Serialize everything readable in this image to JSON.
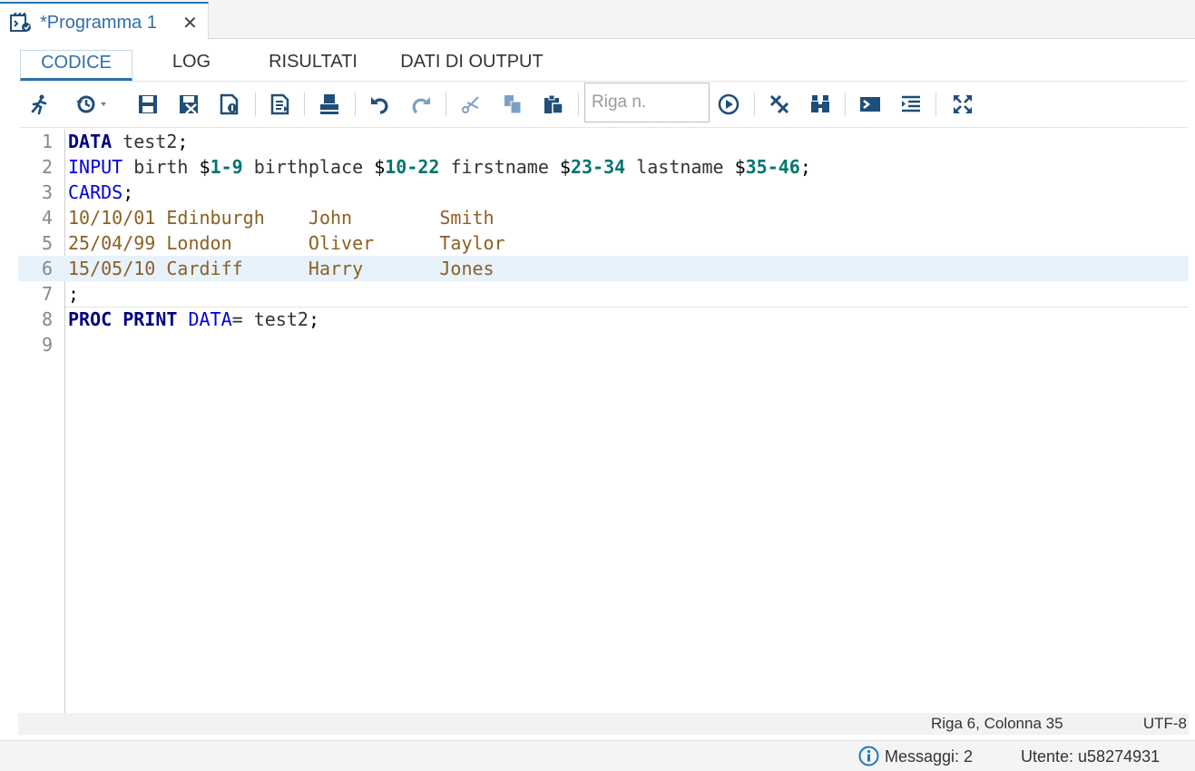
{
  "file_tab": {
    "title": "*Programma 1",
    "close_glyph": "✕",
    "icon": "program-file-icon"
  },
  "sub_tabs": [
    {
      "label": "CODICE",
      "active": true
    },
    {
      "label": "LOG",
      "active": false
    },
    {
      "label": "RISULTATI",
      "active": false
    },
    {
      "label": "DATI DI OUTPUT",
      "active": false
    }
  ],
  "toolbar": {
    "goto_placeholder": "Riga n.",
    "icons": [
      "run-icon",
      "history-icon",
      "save-icon",
      "save-as-icon",
      "save-all-icon",
      "log-icon",
      "print-icon",
      "undo-icon",
      "redo-icon",
      "cut-icon",
      "copy-icon",
      "paste-icon",
      "go-icon",
      "clear-icon",
      "find-icon",
      "submit-icon",
      "format-icon",
      "maximize-icon"
    ]
  },
  "editor": {
    "current_line": 6,
    "line_numbers": [
      "1",
      "2",
      "3",
      "4",
      "5",
      "6",
      "7",
      "8",
      "9"
    ],
    "lines": [
      [
        {
          "t": "DATA",
          "c": "kw-bold"
        },
        {
          "t": " test2",
          "c": "ident"
        },
        {
          "t": ";",
          "c": "punct"
        }
      ],
      [
        {
          "t": "INPUT",
          "c": "kw"
        },
        {
          "t": " birth ",
          "c": "ident"
        },
        {
          "t": "$",
          "c": "punct"
        },
        {
          "t": "1-9",
          "c": "num"
        },
        {
          "t": " birthplace ",
          "c": "ident"
        },
        {
          "t": "$",
          "c": "punct"
        },
        {
          "t": "10-22",
          "c": "num"
        },
        {
          "t": " firstname ",
          "c": "ident"
        },
        {
          "t": "$",
          "c": "punct"
        },
        {
          "t": "23-34",
          "c": "num"
        },
        {
          "t": " lastname ",
          "c": "ident"
        },
        {
          "t": "$",
          "c": "punct"
        },
        {
          "t": "35-46",
          "c": "num"
        },
        {
          "t": ";",
          "c": "punct"
        }
      ],
      [
        {
          "t": "CARDS",
          "c": "kw"
        },
        {
          "t": ";",
          "c": "punct"
        }
      ],
      [
        {
          "t": "10/10/01 Edinburgh    John        Smith",
          "c": "datal"
        }
      ],
      [
        {
          "t": "25/04/99 London       Oliver      Taylor",
          "c": "datal"
        }
      ],
      [
        {
          "t": "15/05/10 Cardiff      Harry       Jones",
          "c": "datal"
        }
      ],
      [
        {
          "t": ";",
          "c": "punct"
        }
      ],
      [
        {
          "t": "PROC PRINT",
          "c": "kw-bold"
        },
        {
          "t": " ",
          "c": "ident"
        },
        {
          "t": "DATA",
          "c": "kw"
        },
        {
          "t": "= test2",
          "c": "ident"
        },
        {
          "t": ";",
          "c": "punct"
        }
      ],
      []
    ]
  },
  "editor_status": {
    "position": "Riga 6, Colonna 35",
    "encoding": "UTF-8"
  },
  "app_status": {
    "messages": "Messaggi: 2",
    "user": "Utente: u58274931"
  }
}
